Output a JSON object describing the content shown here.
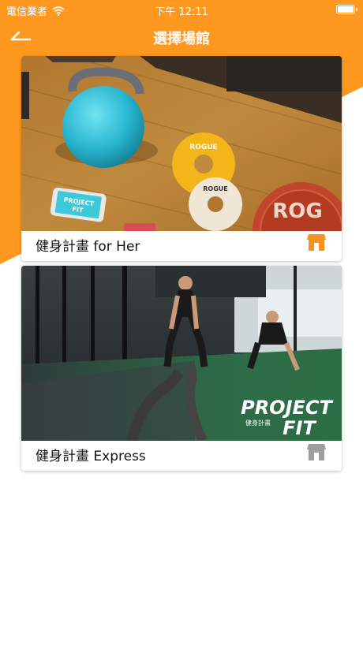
{
  "status_bar": {
    "carrier": "電信業者",
    "time": "下午 12:11"
  },
  "header": {
    "title": "選擇場館"
  },
  "colors": {
    "accent": "#ff981f",
    "store_active": "#f7931e",
    "store_inactive": "#9e9e9e"
  },
  "venues": [
    {
      "name": "健身計畫 for Her",
      "store_icon": "store-icon",
      "active": true,
      "photo": {
        "phone_logo_line1": "PROJECT",
        "phone_logo_line2": "FIT",
        "plate_text": "ROGUE",
        "bumper_text": "ROG"
      }
    },
    {
      "name": "健身計畫 Express",
      "store_icon": "store-icon",
      "active": false,
      "photo": {
        "logo_line1": "PROJECT",
        "logo_line2": "FIT",
        "logo_sub": "健身計畫"
      }
    }
  ]
}
